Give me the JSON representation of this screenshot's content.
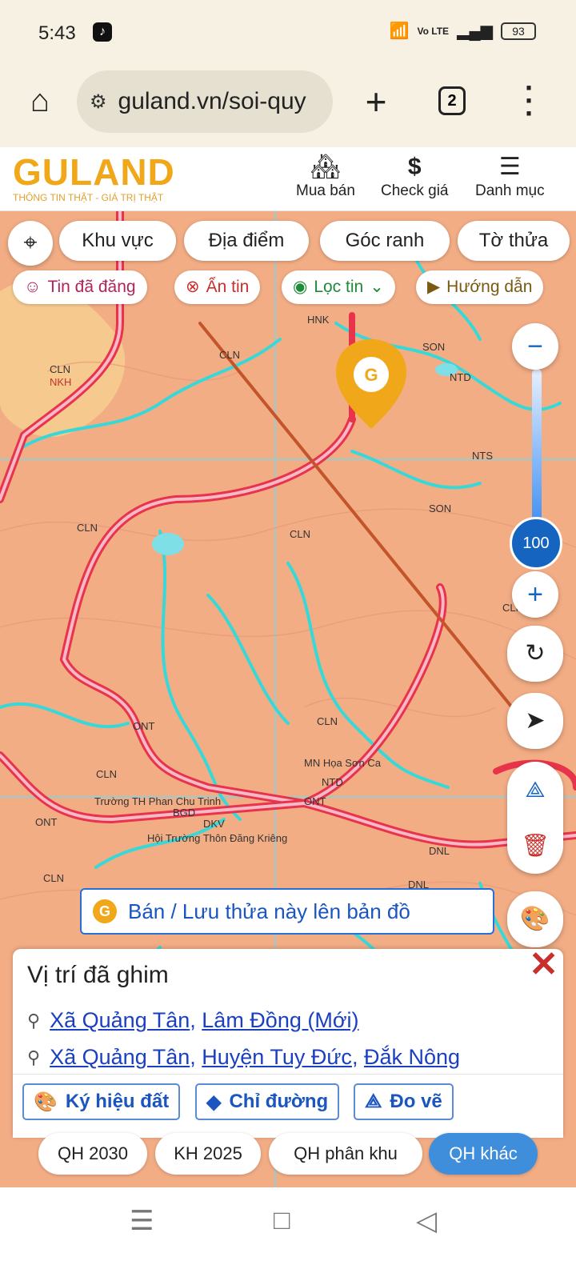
{
  "status": {
    "time": "5:43",
    "battery": "93",
    "network": "Vo LTE"
  },
  "browser": {
    "url": "guland.vn/soi-quy",
    "tab_count": "2"
  },
  "site": {
    "logo": "GULAND",
    "tagline": "THÔNG TIN THẬT - GIÁ TRỊ THẬT",
    "nav": [
      {
        "label": "Mua bán",
        "icon": "building-icon"
      },
      {
        "label": "Check giá",
        "icon": "dollar-icon"
      },
      {
        "label": "Danh mục",
        "icon": "hamburger-icon"
      }
    ]
  },
  "map": {
    "search_tabs": [
      "Khu vực",
      "Địa điểm",
      "Góc ranh",
      "Tờ thửa"
    ],
    "filters": [
      {
        "label": "Tin đã đăng",
        "color": "#b0245a"
      },
      {
        "label": "Ẩn tin",
        "color": "#c9302c"
      },
      {
        "label": "Lọc tin",
        "color": "#1f8a3a"
      },
      {
        "label": "Hướng dẫn",
        "color": "#7a5a10"
      }
    ],
    "zoom_level": "100",
    "labels": [
      "HNK",
      "SON",
      "NTD",
      "CLN",
      "CLN",
      "NKH",
      "CLN",
      "CLN",
      "NTS",
      "SON",
      "CLN",
      "CLN",
      "CLN",
      "NTD",
      "ONT",
      "DKV",
      "DNL",
      "DNL",
      "CLN",
      "ONT",
      "ONT",
      "BGD",
      "Hội Trường Thôn Đăng Kriêng",
      "Trường TH Phan Chu Trinh",
      "MN Họa Sơn Ca"
    ],
    "banner": "Bán / Lưu thửa này lên bản đồ"
  },
  "pinned": {
    "title": "Vị trí đã ghim",
    "line1": {
      "a": "Xã Quảng Tân",
      "b": "Lâm Đồng (Mới)"
    },
    "line2": {
      "a": "Xã Quảng Tân",
      "b": "Huyện Tuy Đức",
      "c": "Đắk Nông"
    },
    "buttons": [
      "Ký hiệu đất",
      "Chỉ đường",
      "Đo vẽ"
    ]
  },
  "plans": [
    "QH 2030",
    "KH 2025",
    "QH phân khu",
    "QH khác"
  ],
  "colors": {
    "map_bg": "#f2ad85",
    "river": "#38d8d8",
    "road": "#e8344a",
    "accent": "#3f8edc",
    "brand": "#f0a81a"
  }
}
